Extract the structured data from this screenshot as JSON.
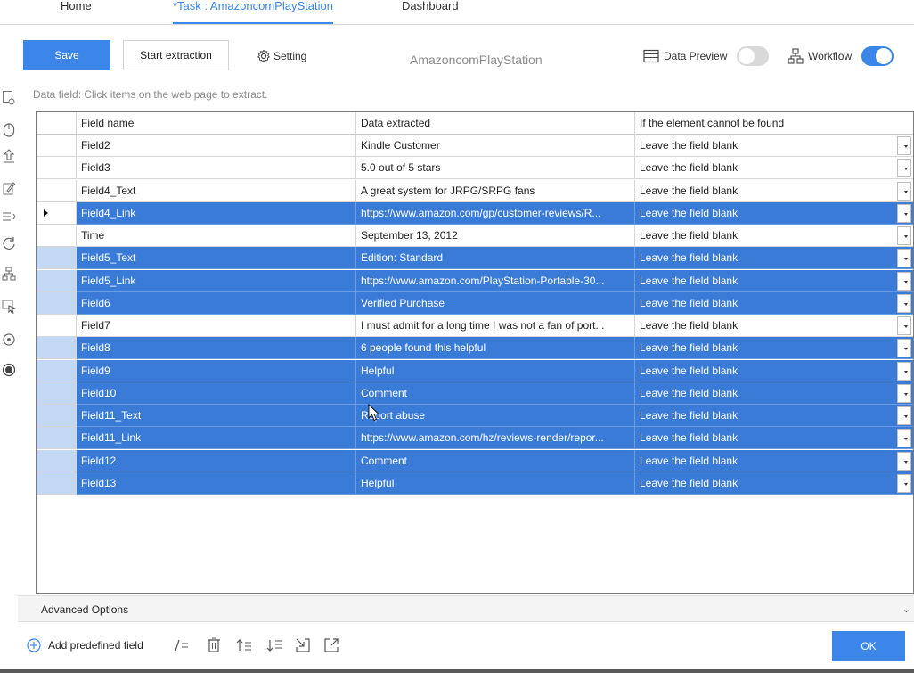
{
  "nav": {
    "tabs": [
      {
        "label": "Home"
      },
      {
        "label": "*Task : AmazoncomPlayStation"
      },
      {
        "label": "Dashboard"
      }
    ]
  },
  "toolbar": {
    "save_label": "Save",
    "start_label": "Start extraction",
    "setting_label": "Setting",
    "task_title": "AmazoncomPlayStation",
    "data_preview_label": "Data Preview",
    "data_preview_on": false,
    "workflow_label": "Workflow",
    "workflow_on": true
  },
  "hint": "Data field: Click items on the web page to extract.",
  "table": {
    "headers": [
      "Field name",
      "Data extracted",
      "If the element cannot be found"
    ],
    "rows": [
      {
        "name": "Field2",
        "data": "Kindle Customer",
        "fallback": "Leave the field blank",
        "selected": false
      },
      {
        "name": "Field3",
        "data": "5.0 out of 5 stars",
        "fallback": "Leave the field blank",
        "selected": false
      },
      {
        "name": "Field4_Text",
        "data": "A great system for JRPG/SRPG fans",
        "fallback": "Leave the field blank",
        "selected": false
      },
      {
        "name": "Field4_Link",
        "data": "https://www.amazon.com/gp/customer-reviews/R...",
        "fallback": "Leave the field blank",
        "selected": true,
        "current": true
      },
      {
        "name": "Time",
        "data": "September 13, 2012",
        "fallback": "Leave the field blank",
        "selected": false
      },
      {
        "name": "Field5_Text",
        "data": "Edition: Standard",
        "fallback": "Leave the field blank",
        "selected": true
      },
      {
        "name": "Field5_Link",
        "data": "https://www.amazon.com/PlayStation-Portable-30...",
        "fallback": "Leave the field blank",
        "selected": true
      },
      {
        "name": "Field6",
        "data": "Verified Purchase",
        "fallback": "Leave the field blank",
        "selected": true
      },
      {
        "name": "Field7",
        "data": "I must admit for a long time I was not a fan of port...",
        "fallback": "Leave the field blank",
        "selected": false
      },
      {
        "name": "Field8",
        "data": "6 people found this helpful",
        "fallback": "Leave the field blank",
        "selected": true
      },
      {
        "name": "Field9",
        "data": "Helpful",
        "fallback": "Leave the field blank",
        "selected": true
      },
      {
        "name": "Field10",
        "data": "Comment",
        "fallback": "Leave the field blank",
        "selected": true
      },
      {
        "name": "Field11_Text",
        "data": "Report abuse",
        "fallback": "Leave the field blank",
        "selected": true
      },
      {
        "name": "Field11_Link",
        "data": "https://www.amazon.com/hz/reviews-render/repor...",
        "fallback": "Leave the field blank",
        "selected": true
      },
      {
        "name": "Field12",
        "data": "Comment",
        "fallback": "Leave the field blank",
        "selected": true
      },
      {
        "name": "Field13",
        "data": "Helpful",
        "fallback": "Leave the field blank",
        "selected": true
      }
    ]
  },
  "advanced_label": "Advanced Options",
  "bottom": {
    "add_label": "Add predefined field",
    "ok_label": "OK"
  },
  "colors": {
    "accent": "#3b86e8",
    "selected_row": "#3b7bd8"
  }
}
